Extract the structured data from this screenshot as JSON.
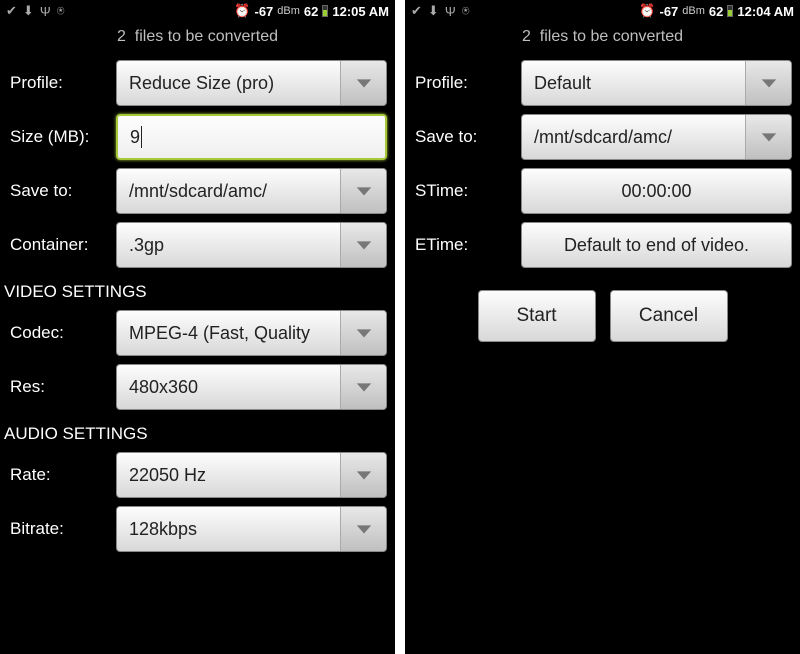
{
  "left": {
    "status": {
      "signal": "-67",
      "unit": "dBm",
      "battery": "62",
      "time": "12:05 AM"
    },
    "files_msg_count": "2",
    "files_msg_text": "files to be converted",
    "labels": {
      "profile": "Profile:",
      "size": "Size (MB):",
      "save_to": "Save to:",
      "container": "Container:",
      "video_section": "VIDEO SETTINGS",
      "codec": "Codec:",
      "res": "Res:",
      "audio_section": "AUDIO SETTINGS",
      "rate": "Rate:",
      "bitrate": "Bitrate:"
    },
    "values": {
      "profile": "Reduce Size (pro)",
      "size": "9",
      "save_to": "/mnt/sdcard/amc/",
      "container": ".3gp",
      "codec": "MPEG-4 (Fast, Quality",
      "res": "480x360",
      "rate": "22050 Hz",
      "bitrate": "128kbps"
    }
  },
  "right": {
    "status": {
      "signal": "-67",
      "unit": "dBm",
      "battery": "62",
      "time": "12:04 AM"
    },
    "files_msg_count": "2",
    "files_msg_text": "files to be converted",
    "labels": {
      "profile": "Profile:",
      "save_to": "Save to:",
      "stime": "STime:",
      "etime": "ETime:"
    },
    "values": {
      "profile": "Default",
      "save_to": "/mnt/sdcard/amc/",
      "stime": "00:00:00",
      "etime": "Default to end of video."
    },
    "buttons": {
      "start": "Start",
      "cancel": "Cancel"
    }
  }
}
